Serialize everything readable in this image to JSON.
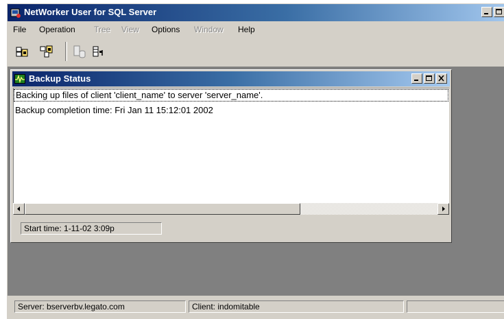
{
  "window": {
    "title": "NetWorker User for SQL Server"
  },
  "menu": [
    {
      "label": "File",
      "enabled": true
    },
    {
      "label": "Operation",
      "enabled": true
    },
    {
      "label": "Tree",
      "enabled": false
    },
    {
      "label": "View",
      "enabled": false
    },
    {
      "label": "Options",
      "enabled": true
    },
    {
      "label": "Window",
      "enabled": false
    },
    {
      "label": "Help",
      "enabled": true
    }
  ],
  "toolbar": {
    "buttons": [
      {
        "icon": "backup-icon",
        "enabled": true
      },
      {
        "icon": "restore-icon",
        "enabled": true
      },
      {
        "icon": "database-icon",
        "enabled": false
      },
      {
        "icon": "start-icon",
        "enabled": true
      }
    ]
  },
  "backup_status": {
    "title": "Backup Status",
    "lines": [
      "Backing up files of client 'client_name' to server 'server_name'.",
      "Backup completion time: Fri Jan 11 15:12:01 2002"
    ],
    "start_time": "Start time:  1-11-02  3:09p"
  },
  "statusbar": {
    "server": "Server: bserverbv.legato.com",
    "client": "Client: indomitable",
    "extra": ""
  },
  "colors": {
    "title_active": "#0a246a",
    "title_fade": "#a6caf0",
    "face": "#d4d0c8",
    "mdi_background": "#808080"
  }
}
